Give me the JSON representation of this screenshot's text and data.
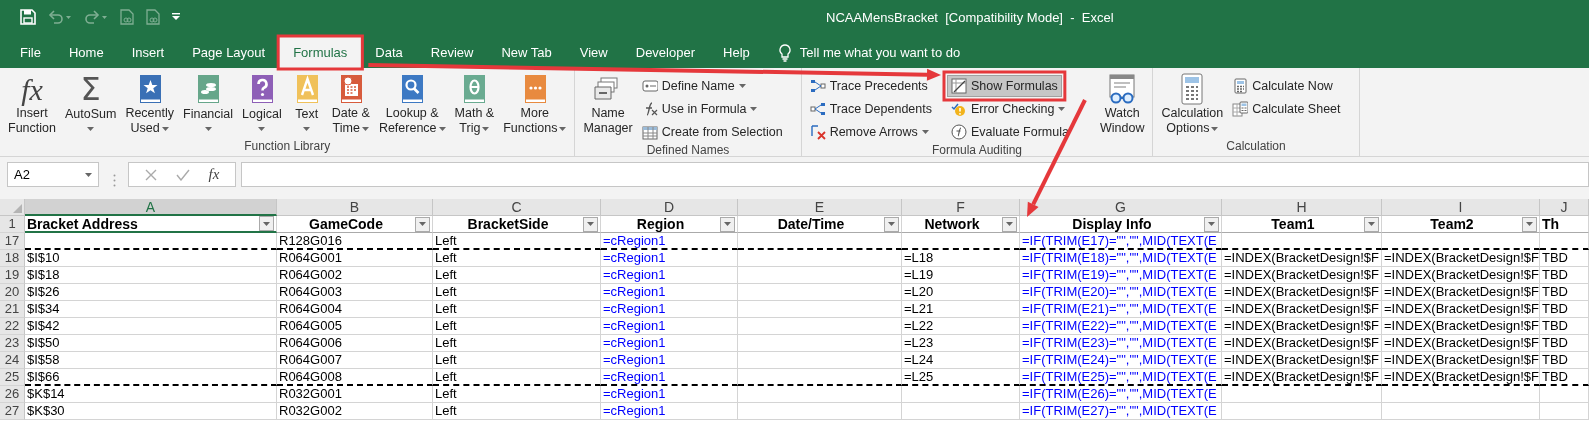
{
  "window": {
    "title": "NCAAMensBracket  [Compatibility Mode]  -  Excel"
  },
  "quick_access": [
    {
      "kind": "save",
      "disabled": false
    },
    {
      "kind": "undo",
      "disabled": true
    },
    {
      "kind": "redo",
      "disabled": true
    },
    {
      "kind": "document",
      "disabled": true
    },
    {
      "kind": "document",
      "disabled": true
    },
    {
      "kind": "customize",
      "disabled": false
    }
  ],
  "tabs": [
    {
      "label": "File",
      "selected": false,
      "highlighted": false
    },
    {
      "label": "Home",
      "selected": false,
      "highlighted": false
    },
    {
      "label": "Insert",
      "selected": false,
      "highlighted": false
    },
    {
      "label": "Page Layout",
      "selected": false,
      "highlighted": false
    },
    {
      "label": "Formulas",
      "selected": true,
      "highlighted": true,
      "arrow_out": true
    },
    {
      "label": "Data",
      "selected": false,
      "highlighted": false
    },
    {
      "label": "Review",
      "selected": false,
      "highlighted": false
    },
    {
      "label": "New Tab",
      "selected": false,
      "highlighted": false
    },
    {
      "label": "View",
      "selected": false,
      "highlighted": false
    },
    {
      "label": "Developer",
      "selected": false,
      "highlighted": false
    },
    {
      "label": "Help",
      "selected": false,
      "highlighted": false
    }
  ],
  "tell_me": {
    "text": "Tell me what you want to do"
  },
  "ribbon": {
    "groups": [
      {
        "label": "Function Library",
        "columns": [
          {
            "kind": "large",
            "commands": [
              {
                "kind": "insert_function",
                "glyph": "fx",
                "lines": [
                  "Insert",
                  "Function"
                ],
                "dropdown": false
              }
            ]
          },
          {
            "kind": "large",
            "commands": [
              {
                "kind": "autosum",
                "glyph": "Σ",
                "lines": [
                  "AutoSum"
                ],
                "dropdown": true
              }
            ]
          },
          {
            "kind": "large",
            "commands": [
              {
                "kind": "recently_used",
                "lines": [
                  "Recently",
                  "Used"
                ],
                "dropdown": true
              }
            ]
          },
          {
            "kind": "large",
            "commands": [
              {
                "kind": "financial",
                "lines": [
                  "Financial"
                ],
                "dropdown": true
              }
            ]
          },
          {
            "kind": "large",
            "commands": [
              {
                "kind": "logical",
                "lines": [
                  "Logical"
                ],
                "dropdown": true
              }
            ]
          },
          {
            "kind": "large",
            "commands": [
              {
                "kind": "text",
                "lines": [
                  "Text"
                ],
                "dropdown": true
              }
            ]
          },
          {
            "kind": "large",
            "commands": [
              {
                "kind": "date_time",
                "lines": [
                  "Date &",
                  "Time"
                ],
                "dropdown": true
              }
            ]
          },
          {
            "kind": "large",
            "commands": [
              {
                "kind": "lookup_reference",
                "lines": [
                  "Lookup &",
                  "Reference"
                ],
                "dropdown": true
              }
            ]
          },
          {
            "kind": "large",
            "commands": [
              {
                "kind": "math_trig",
                "lines": [
                  "Math &",
                  "Trig"
                ],
                "dropdown": true
              }
            ]
          },
          {
            "kind": "large",
            "commands": [
              {
                "kind": "more_functions",
                "lines": [
                  "More",
                  "Functions"
                ],
                "dropdown": true
              }
            ]
          }
        ]
      },
      {
        "label": "Defined Names",
        "columns": [
          {
            "kind": "large",
            "commands": [
              {
                "kind": "name_manager",
                "lines": [
                  "Name",
                  "Manager"
                ],
                "dropdown": false
              }
            ]
          },
          {
            "kind": "stack",
            "commands": [
              {
                "kind": "define_name",
                "lines": [
                  "Define Name"
                ],
                "dropdown": true
              },
              {
                "kind": "use_in_formula",
                "lines": [
                  "Use in Formula"
                ],
                "dropdown": true
              },
              {
                "kind": "create_from_selection",
                "lines": [
                  "Create from Selection"
                ],
                "dropdown": false
              }
            ]
          }
        ]
      },
      {
        "label": "Formula Auditing",
        "columns": [
          {
            "kind": "stack",
            "commands": [
              {
                "kind": "trace_precedents",
                "lines": [
                  "Trace Precedents"
                ],
                "dropdown": false
              },
              {
                "kind": "trace_dependents",
                "lines": [
                  "Trace Dependents"
                ],
                "dropdown": false
              },
              {
                "kind": "remove_arrows",
                "lines": [
                  "Remove Arrows"
                ],
                "dropdown": true
              }
            ]
          },
          {
            "kind": "stack",
            "commands": [
              {
                "kind": "show_formulas",
                "lines": [
                  "Show Formulas"
                ],
                "dropdown": false,
                "pressed": true,
                "highlighted": true,
                "arrow_out": true
              },
              {
                "kind": "error_checking",
                "lines": [
                  "Error Checking"
                ],
                "dropdown": true
              },
              {
                "kind": "evaluate_formula",
                "lines": [
                  "Evaluate Formula"
                ],
                "dropdown": false
              }
            ]
          },
          {
            "kind": "large",
            "commands": [
              {
                "kind": "watch_window",
                "lines": [
                  "Watch",
                  "Window"
                ],
                "dropdown": false
              }
            ]
          }
        ]
      },
      {
        "label": "Calculation",
        "columns": [
          {
            "kind": "large",
            "commands": [
              {
                "kind": "calculation_options",
                "lines": [
                  "Calculation",
                  "Options"
                ],
                "dropdown": true
              }
            ]
          },
          {
            "kind": "stack",
            "commands": [
              {
                "kind": "calculate_now",
                "lines": [
                  "Calculate Now"
                ],
                "dropdown": false
              },
              {
                "kind": "calculate_sheet",
                "lines": [
                  "Calculate Sheet"
                ],
                "dropdown": false
              }
            ]
          }
        ]
      }
    ]
  },
  "formula_bar": {
    "name_box": "A2",
    "function_glyph": "fx"
  },
  "sheet": {
    "header_row_number": "1",
    "columns": [
      {
        "letter": "A",
        "header": "Bracket Address",
        "centered": false,
        "filter": true,
        "selected": true
      },
      {
        "letter": "B",
        "header": "GameCode",
        "centered": true,
        "filter": true,
        "selected": false
      },
      {
        "letter": "C",
        "header": "BracketSide",
        "centered": true,
        "filter": true,
        "selected": false
      },
      {
        "letter": "D",
        "header": "Region",
        "centered": true,
        "filter": true,
        "selected": false,
        "color": "#0000ff"
      },
      {
        "letter": "E",
        "header": "Date/Time",
        "centered": true,
        "filter": true,
        "selected": false
      },
      {
        "letter": "F",
        "header": "Network",
        "centered": true,
        "filter": true,
        "selected": false
      },
      {
        "letter": "G",
        "header": "Display Info",
        "centered": true,
        "filter": true,
        "selected": false,
        "color": "#0000ff",
        "arrow_target": true
      },
      {
        "letter": "H",
        "header": "Team1",
        "centered": true,
        "filter": true,
        "selected": false
      },
      {
        "letter": "I",
        "header": "Team2",
        "centered": true,
        "filter": true,
        "selected": false
      },
      {
        "letter": "J",
        "header": "Th",
        "centered": false,
        "filter": false,
        "selected": false
      }
    ],
    "rows": [
      {
        "number": "17",
        "page_break": true,
        "cells": {
          "B": "R128G016",
          "C": "Left",
          "D": "=cRegion1",
          "G": "=IF(TRIM(E17)=\"\",\"\",MID(TEXT(E"
        }
      },
      {
        "number": "18",
        "page_break": false,
        "cells": {
          "A": "$I$10",
          "B": "R064G001",
          "C": "Left",
          "D": "=cRegion1",
          "F": "=L18",
          "G": "=IF(TRIM(E18)=\"\",\"\",MID(TEXT(E",
          "H": "=INDEX(BracketDesign!$F",
          "I": "=INDEX(BracketDesign!$F",
          "J": "TBD"
        }
      },
      {
        "number": "19",
        "page_break": false,
        "cells": {
          "A": "$I$18",
          "B": "R064G002",
          "C": "Left",
          "D": "=cRegion1",
          "F": "=L19",
          "G": "=IF(TRIM(E19)=\"\",\"\",MID(TEXT(E",
          "H": "=INDEX(BracketDesign!$F",
          "I": "=INDEX(BracketDesign!$F",
          "J": "TBD"
        }
      },
      {
        "number": "20",
        "page_break": false,
        "cells": {
          "A": "$I$26",
          "B": "R064G003",
          "C": "Left",
          "D": "=cRegion1",
          "F": "=L20",
          "G": "=IF(TRIM(E20)=\"\",\"\",MID(TEXT(E",
          "H": "=INDEX(BracketDesign!$F",
          "I": "=INDEX(BracketDesign!$F",
          "J": "TBD"
        }
      },
      {
        "number": "21",
        "page_break": false,
        "cells": {
          "A": "$I$34",
          "B": "R064G004",
          "C": "Left",
          "D": "=cRegion1",
          "F": "=L21",
          "G": "=IF(TRIM(E21)=\"\",\"\",MID(TEXT(E",
          "H": "=INDEX(BracketDesign!$F",
          "I": "=INDEX(BracketDesign!$F",
          "J": "TBD"
        }
      },
      {
        "number": "22",
        "page_break": false,
        "cells": {
          "A": "$I$42",
          "B": "R064G005",
          "C": "Left",
          "D": "=cRegion1",
          "F": "=L22",
          "G": "=IF(TRIM(E22)=\"\",\"\",MID(TEXT(E",
          "H": "=INDEX(BracketDesign!$F",
          "I": "=INDEX(BracketDesign!$F",
          "J": "TBD"
        }
      },
      {
        "number": "23",
        "page_break": false,
        "cells": {
          "A": "$I$50",
          "B": "R064G006",
          "C": "Left",
          "D": "=cRegion1",
          "F": "=L23",
          "G": "=IF(TRIM(E23)=\"\",\"\",MID(TEXT(E",
          "H": "=INDEX(BracketDesign!$F",
          "I": "=INDEX(BracketDesign!$F",
          "J": "TBD"
        }
      },
      {
        "number": "24",
        "page_break": false,
        "cells": {
          "A": "$I$58",
          "B": "R064G007",
          "C": "Left",
          "D": "=cRegion1",
          "F": "=L24",
          "G": "=IF(TRIM(E24)=\"\",\"\",MID(TEXT(E",
          "H": "=INDEX(BracketDesign!$F",
          "I": "=INDEX(BracketDesign!$F",
          "J": "TBD"
        }
      },
      {
        "number": "25",
        "page_break": true,
        "cells": {
          "A": "$I$66",
          "B": "R064G008",
          "C": "Left",
          "D": "=cRegion1",
          "F": "=L25",
          "G": "=IF(TRIM(E25)=\"\",\"\",MID(TEXT(E",
          "H": "=INDEX(BracketDesign!$F",
          "I": "=INDEX(BracketDesign!$F",
          "J": "TBD"
        }
      },
      {
        "number": "26",
        "page_break": false,
        "cells": {
          "A": "$K$14",
          "B": "R032G001",
          "C": "Left",
          "D": "=cRegion1",
          "G": "=IF(TRIM(E26)=\"\",\"\",MID(TEXT(E"
        }
      },
      {
        "number": "27",
        "page_break": false,
        "cells": {
          "A": "$K$30",
          "B": "R032G002",
          "C": "Left",
          "D": "=cRegion1",
          "G": "=IF(TRIM(E27)=\"\",\"\",MID(TEXT(E"
        }
      }
    ]
  }
}
